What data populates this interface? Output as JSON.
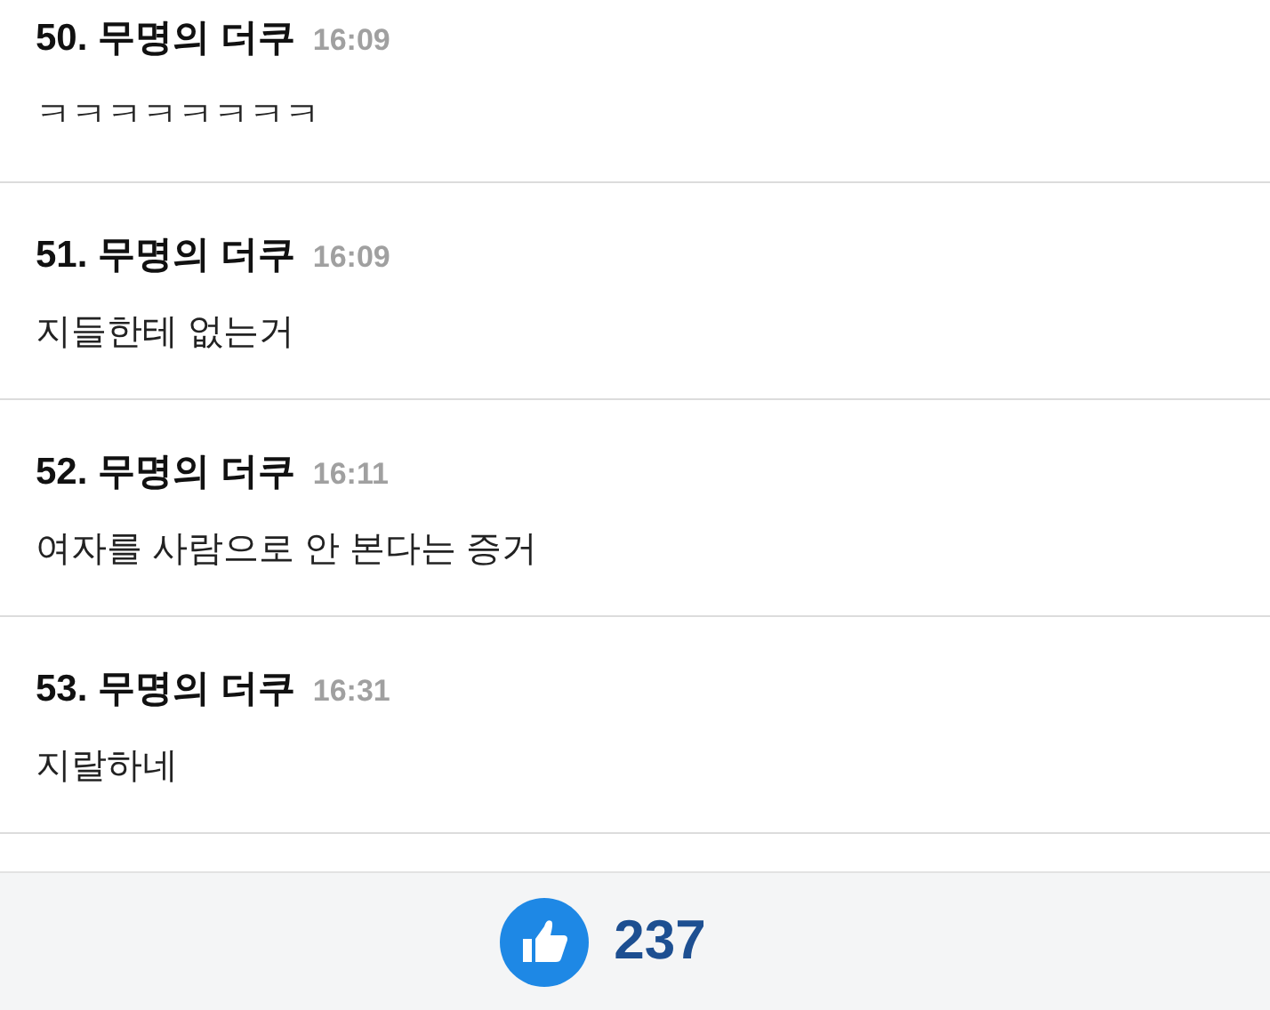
{
  "comments": [
    {
      "number": "50.",
      "author": "무명의 더쿠",
      "time": "16:09",
      "text": "ㅋㅋㅋㅋㅋㅋㅋㅋ"
    },
    {
      "number": "51.",
      "author": "무명의 더쿠",
      "time": "16:09",
      "text": "지들한테 없는거"
    },
    {
      "number": "52.",
      "author": "무명의 더쿠",
      "time": "16:11",
      "text": "여자를 사람으로 안 본다는 증거"
    },
    {
      "number": "53.",
      "author": "무명의 더쿠",
      "time": "16:31",
      "text": "지랄하네"
    }
  ],
  "footer": {
    "like_count": "237"
  }
}
